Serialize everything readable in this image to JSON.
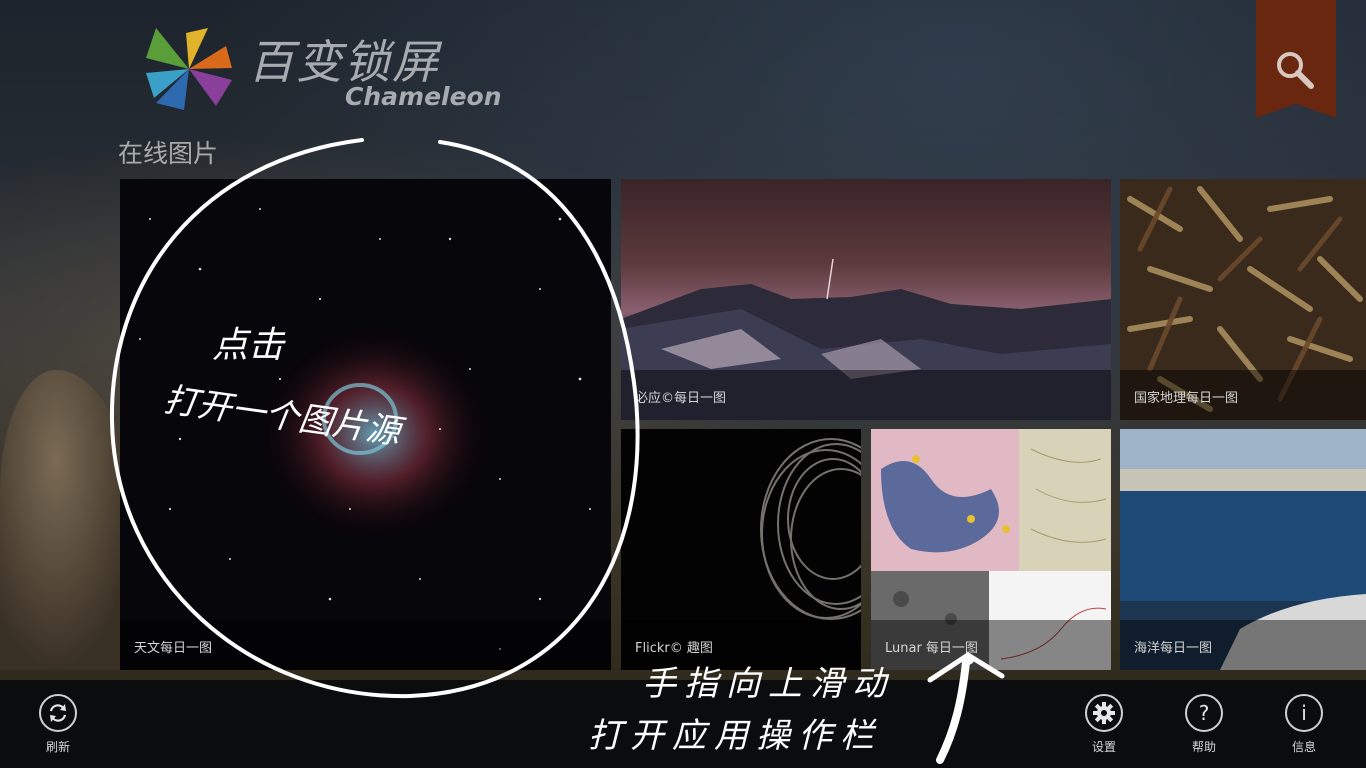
{
  "app": {
    "title_cn": "百变锁屏",
    "title_en": "Chameleon",
    "section_title": "在线图片"
  },
  "tiles": [
    {
      "label": "天文每日一图"
    },
    {
      "label": "必应©每日一图"
    },
    {
      "label": "国家地理每日一图"
    },
    {
      "label": "Flickr© 趣图"
    },
    {
      "label": "Lunar 每日一图"
    },
    {
      "label": "海洋每日一图"
    }
  ],
  "appbar": {
    "refresh": "刷新",
    "settings": "设置",
    "help": "帮助",
    "info": "信息"
  },
  "annotations": {
    "tap_line1": "点击",
    "tap_line2": "打开一个图片源",
    "swipe_line1": "手指向上滑动",
    "swipe_line2": "打开应用操作栏"
  },
  "colors": {
    "search_flag": "#6a2710",
    "appbar": "#0b0c0e"
  },
  "icons": {
    "search": "search-icon",
    "refresh": "refresh-icon",
    "settings": "gear-icon",
    "help": "question-icon",
    "info": "info-icon"
  }
}
